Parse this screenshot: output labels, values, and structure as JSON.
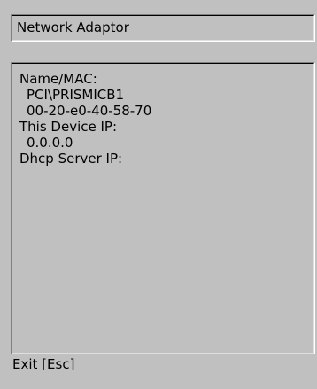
{
  "header": {
    "title": "Network Adaptor"
  },
  "info": {
    "name_mac_label": "Name/MAC:",
    "adapter_name": "PCI\\PRISMICB1",
    "mac_address": "00-20-e0-40-58-70",
    "device_ip_label": "This Device IP:",
    "device_ip": "0.0.0.0",
    "dhcp_server_label": "Dhcp Server IP:",
    "dhcp_server_ip": ""
  },
  "footer": {
    "exit_label": "Exit [Esc]"
  }
}
